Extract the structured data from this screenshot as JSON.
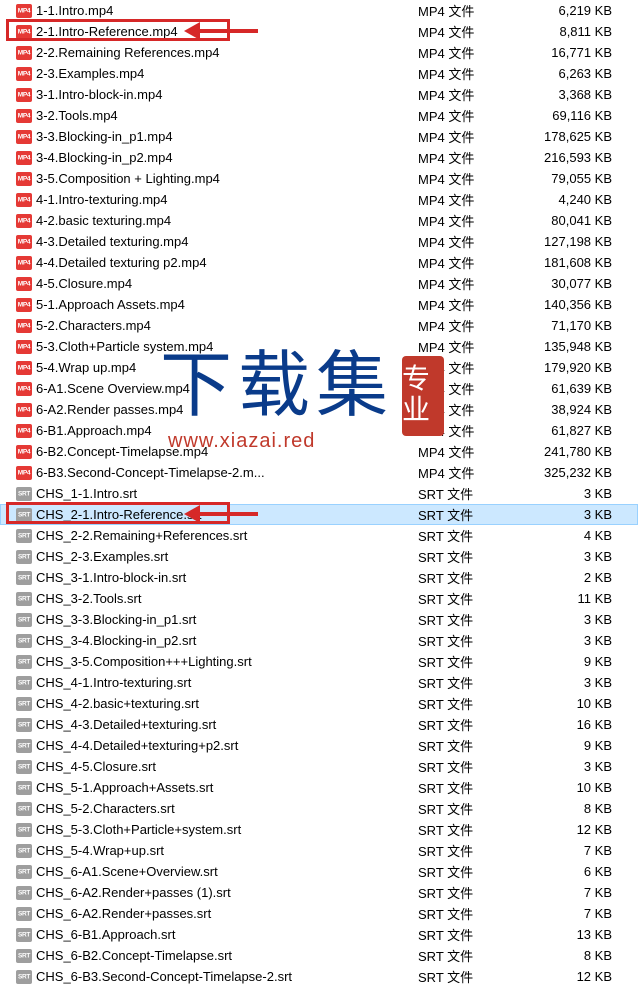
{
  "files": [
    {
      "name": "1-1.Intro.mp4",
      "type": "MP4 文件",
      "size": "6,219 KB",
      "icon": "mp4"
    },
    {
      "name": "2-1.Intro-Reference.mp4",
      "type": "MP4 文件",
      "size": "8,811 KB",
      "icon": "mp4",
      "highlighted": true
    },
    {
      "name": "2-2.Remaining References.mp4",
      "type": "MP4 文件",
      "size": "16,771 KB",
      "icon": "mp4"
    },
    {
      "name": "2-3.Examples.mp4",
      "type": "MP4 文件",
      "size": "6,263 KB",
      "icon": "mp4"
    },
    {
      "name": "3-1.Intro-block-in.mp4",
      "type": "MP4 文件",
      "size": "3,368 KB",
      "icon": "mp4"
    },
    {
      "name": "3-2.Tools.mp4",
      "type": "MP4 文件",
      "size": "69,116 KB",
      "icon": "mp4"
    },
    {
      "name": "3-3.Blocking-in_p1.mp4",
      "type": "MP4 文件",
      "size": "178,625 KB",
      "icon": "mp4"
    },
    {
      "name": "3-4.Blocking-in_p2.mp4",
      "type": "MP4 文件",
      "size": "216,593 KB",
      "icon": "mp4"
    },
    {
      "name": "3-5.Composition + Lighting.mp4",
      "type": "MP4 文件",
      "size": "79,055 KB",
      "icon": "mp4"
    },
    {
      "name": "4-1.Intro-texturing.mp4",
      "type": "MP4 文件",
      "size": "4,240 KB",
      "icon": "mp4"
    },
    {
      "name": "4-2.basic texturing.mp4",
      "type": "MP4 文件",
      "size": "80,041 KB",
      "icon": "mp4"
    },
    {
      "name": "4-3.Detailed texturing.mp4",
      "type": "MP4 文件",
      "size": "127,198 KB",
      "icon": "mp4"
    },
    {
      "name": "4-4.Detailed texturing p2.mp4",
      "type": "MP4 文件",
      "size": "181,608 KB",
      "icon": "mp4"
    },
    {
      "name": "4-5.Closure.mp4",
      "type": "MP4 文件",
      "size": "30,077 KB",
      "icon": "mp4"
    },
    {
      "name": "5-1.Approach Assets.mp4",
      "type": "MP4 文件",
      "size": "140,356 KB",
      "icon": "mp4"
    },
    {
      "name": "5-2.Characters.mp4",
      "type": "MP4 文件",
      "size": "71,170 KB",
      "icon": "mp4"
    },
    {
      "name": "5-3.Cloth+Particle system.mp4",
      "type": "MP4 文件",
      "size": "135,948 KB",
      "icon": "mp4"
    },
    {
      "name": "5-4.Wrap up.mp4",
      "type": "MP4 文件",
      "size": "179,920 KB",
      "icon": "mp4"
    },
    {
      "name": "6-A1.Scene Overview.mp4",
      "type": "MP4 文件",
      "size": "61,639 KB",
      "icon": "mp4"
    },
    {
      "name": "6-A2.Render passes.mp4",
      "type": "MP4 文件",
      "size": "38,924 KB",
      "icon": "mp4"
    },
    {
      "name": "6-B1.Approach.mp4",
      "type": "MP4 文件",
      "size": "61,827 KB",
      "icon": "mp4"
    },
    {
      "name": "6-B2.Concept-Timelapse.mp4",
      "type": "MP4 文件",
      "size": "241,780 KB",
      "icon": "mp4"
    },
    {
      "name": "6-B3.Second-Concept-Timelapse-2.m...",
      "type": "MP4 文件",
      "size": "325,232 KB",
      "icon": "mp4"
    },
    {
      "name": "CHS_1-1.Intro.srt",
      "type": "SRT 文件",
      "size": "3 KB",
      "icon": "srt"
    },
    {
      "name": "CHS_2-1.Intro-Reference.srt",
      "type": "SRT 文件",
      "size": "3 KB",
      "icon": "srt",
      "highlighted": true,
      "selected": true
    },
    {
      "name": "CHS_2-2.Remaining+References.srt",
      "type": "SRT 文件",
      "size": "4 KB",
      "icon": "srt"
    },
    {
      "name": "CHS_2-3.Examples.srt",
      "type": "SRT 文件",
      "size": "3 KB",
      "icon": "srt"
    },
    {
      "name": "CHS_3-1.Intro-block-in.srt",
      "type": "SRT 文件",
      "size": "2 KB",
      "icon": "srt"
    },
    {
      "name": "CHS_3-2.Tools.srt",
      "type": "SRT 文件",
      "size": "11 KB",
      "icon": "srt"
    },
    {
      "name": "CHS_3-3.Blocking-in_p1.srt",
      "type": "SRT 文件",
      "size": "3 KB",
      "icon": "srt"
    },
    {
      "name": "CHS_3-4.Blocking-in_p2.srt",
      "type": "SRT 文件",
      "size": "3 KB",
      "icon": "srt"
    },
    {
      "name": "CHS_3-5.Composition+++Lighting.srt",
      "type": "SRT 文件",
      "size": "9 KB",
      "icon": "srt"
    },
    {
      "name": "CHS_4-1.Intro-texturing.srt",
      "type": "SRT 文件",
      "size": "3 KB",
      "icon": "srt"
    },
    {
      "name": "CHS_4-2.basic+texturing.srt",
      "type": "SRT 文件",
      "size": "10 KB",
      "icon": "srt"
    },
    {
      "name": "CHS_4-3.Detailed+texturing.srt",
      "type": "SRT 文件",
      "size": "16 KB",
      "icon": "srt"
    },
    {
      "name": "CHS_4-4.Detailed+texturing+p2.srt",
      "type": "SRT 文件",
      "size": "9 KB",
      "icon": "srt"
    },
    {
      "name": "CHS_4-5.Closure.srt",
      "type": "SRT 文件",
      "size": "3 KB",
      "icon": "srt"
    },
    {
      "name": "CHS_5-1.Approach+Assets.srt",
      "type": "SRT 文件",
      "size": "10 KB",
      "icon": "srt"
    },
    {
      "name": "CHS_5-2.Characters.srt",
      "type": "SRT 文件",
      "size": "8 KB",
      "icon": "srt"
    },
    {
      "name": "CHS_5-3.Cloth+Particle+system.srt",
      "type": "SRT 文件",
      "size": "12 KB",
      "icon": "srt"
    },
    {
      "name": "CHS_5-4.Wrap+up.srt",
      "type": "SRT 文件",
      "size": "7 KB",
      "icon": "srt"
    },
    {
      "name": "CHS_6-A1.Scene+Overview.srt",
      "type": "SRT 文件",
      "size": "6 KB",
      "icon": "srt"
    },
    {
      "name": "CHS_6-A2.Render+passes (1).srt",
      "type": "SRT 文件",
      "size": "7 KB",
      "icon": "srt"
    },
    {
      "name": "CHS_6-A2.Render+passes.srt",
      "type": "SRT 文件",
      "size": "7 KB",
      "icon": "srt"
    },
    {
      "name": "CHS_6-B1.Approach.srt",
      "type": "SRT 文件",
      "size": "13 KB",
      "icon": "srt"
    },
    {
      "name": "CHS_6-B2.Concept-Timelapse.srt",
      "type": "SRT 文件",
      "size": "8 KB",
      "icon": "srt"
    },
    {
      "name": "CHS_6-B3.Second-Concept-Timelapse-2.srt",
      "type": "SRT 文件",
      "size": "12 KB",
      "icon": "srt"
    }
  ],
  "watermark": {
    "cn": "下载集",
    "seal": "专业",
    "url": "www.xiazai.red"
  }
}
